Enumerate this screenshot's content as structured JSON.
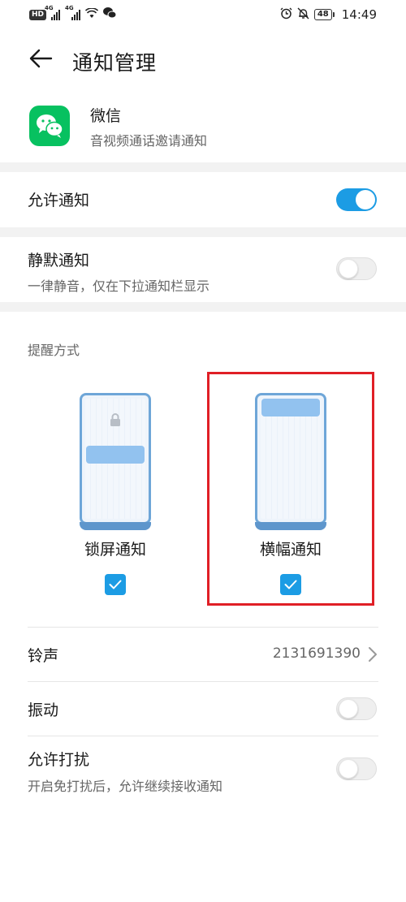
{
  "status_bar": {
    "hd": "HD",
    "sig1": "4G",
    "sig2": "4G",
    "battery": "48",
    "time": "14:49"
  },
  "header": {
    "title": "通知管理"
  },
  "app": {
    "name": "微信",
    "subtitle": "音视频通话邀请通知",
    "icon_color": "#07c160"
  },
  "allow_notifications": {
    "label": "允许通知",
    "on": true
  },
  "silent_notifications": {
    "label": "静默通知",
    "subtitle": "一律静音，仅在下拉通知栏显示",
    "on": false
  },
  "reminder": {
    "title": "提醒方式",
    "options": [
      {
        "label": "锁屏通知",
        "checked": true
      },
      {
        "label": "横幅通知",
        "checked": true
      }
    ]
  },
  "ringtone": {
    "label": "铃声",
    "value": "2131691390"
  },
  "vibration": {
    "label": "振动",
    "on": false
  },
  "allow_dnd": {
    "label": "允许打扰",
    "subtitle": "开启免打扰后，允许继续接收通知",
    "on": false
  },
  "colors": {
    "accent": "#1c9ce4",
    "highlight": "#e01f26"
  }
}
